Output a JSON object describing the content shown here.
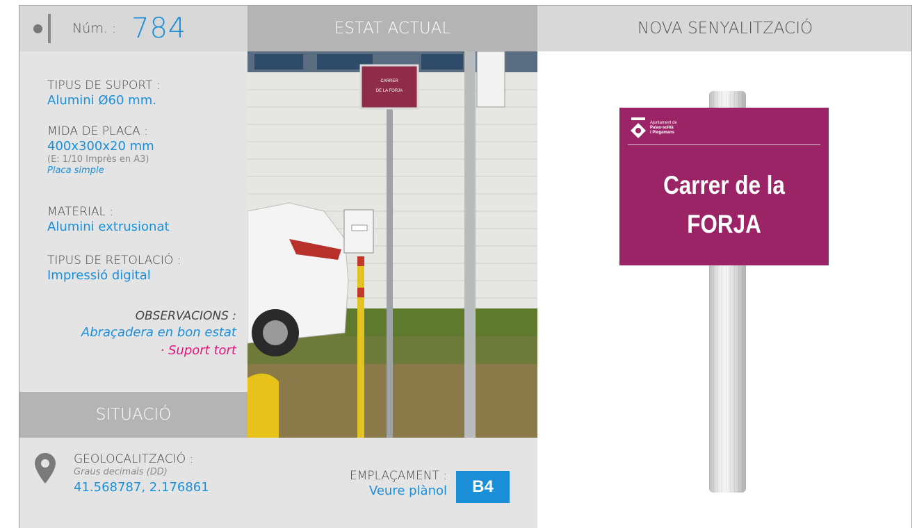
{
  "header": {
    "num_label": "Núm. :",
    "num_value": "784",
    "estat_actual": "ESTAT ACTUAL",
    "nova_senyalitzacio": "NOVA SENYALITZACIÓ"
  },
  "specs": {
    "tipus_suport_label": "TIPUS DE SUPORT :",
    "tipus_suport_value": "Alumini Ø60 mm.",
    "mida_placa_label": "MIDA DE PLACA :",
    "mida_placa_value": "400x300x20 mm",
    "mida_placa_note": "(E: 1/10 Imprès en A3)",
    "mida_placa_type": "Placa simple",
    "material_label": "MATERIAL :",
    "material_value": "Alumini extrusionat",
    "retolacio_label": "TIPUS DE RETOLACIÓ :",
    "retolacio_value": "Impressió digital",
    "observacions_label": "OBSERVACIONS :",
    "observacions_line1": "Abraçadera en bon estat",
    "observacions_line2": "· Suport tort"
  },
  "situacio": {
    "title": "SITUACIÓ",
    "geo_label": "GEOLOCALITZACIÓ :",
    "geo_note": "Graus decimals (DD)",
    "geo_value": "41.568787, 2.176861",
    "emplacament_label": "EMPLAÇAMENT :",
    "emplacament_link": "Veure plànol",
    "emplacament_code": "B4"
  },
  "photo": {
    "sign_line1": "CARRER",
    "sign_line2": "DE LA FORJA"
  },
  "new_sign": {
    "logo_line1": "Ajuntament de",
    "logo_line2": "Palau-solità",
    "logo_line3": "i Plegamans",
    "text_line1": "Carrer de la",
    "text_line2": "FORJA"
  },
  "colors": {
    "accent_blue": "#1a8fd8",
    "accent_pink": "#e0197d",
    "sign_magenta": "#9b2467"
  }
}
